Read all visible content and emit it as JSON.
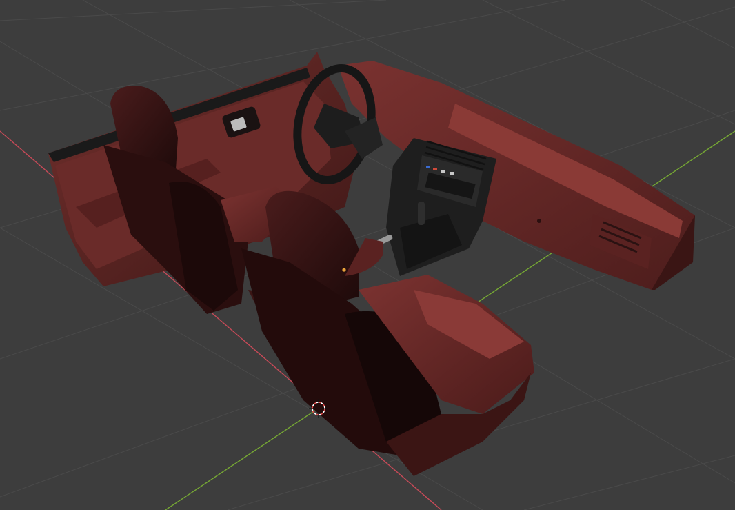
{
  "viewport": {
    "mode": "3d-viewport",
    "background_color": "#3d3d3d",
    "grid_color": "#4a4a4a",
    "axis_x_color": "#d94a5a",
    "axis_y_color": "#7fb53a",
    "origin_color": "#e8a33a",
    "cursor_icon": "3d-cursor-icon",
    "model": {
      "name": "car-interior",
      "primary_color": "#6e2a28",
      "shadow_color": "#2b0f0f",
      "trim_color": "#1c1c1c"
    }
  }
}
